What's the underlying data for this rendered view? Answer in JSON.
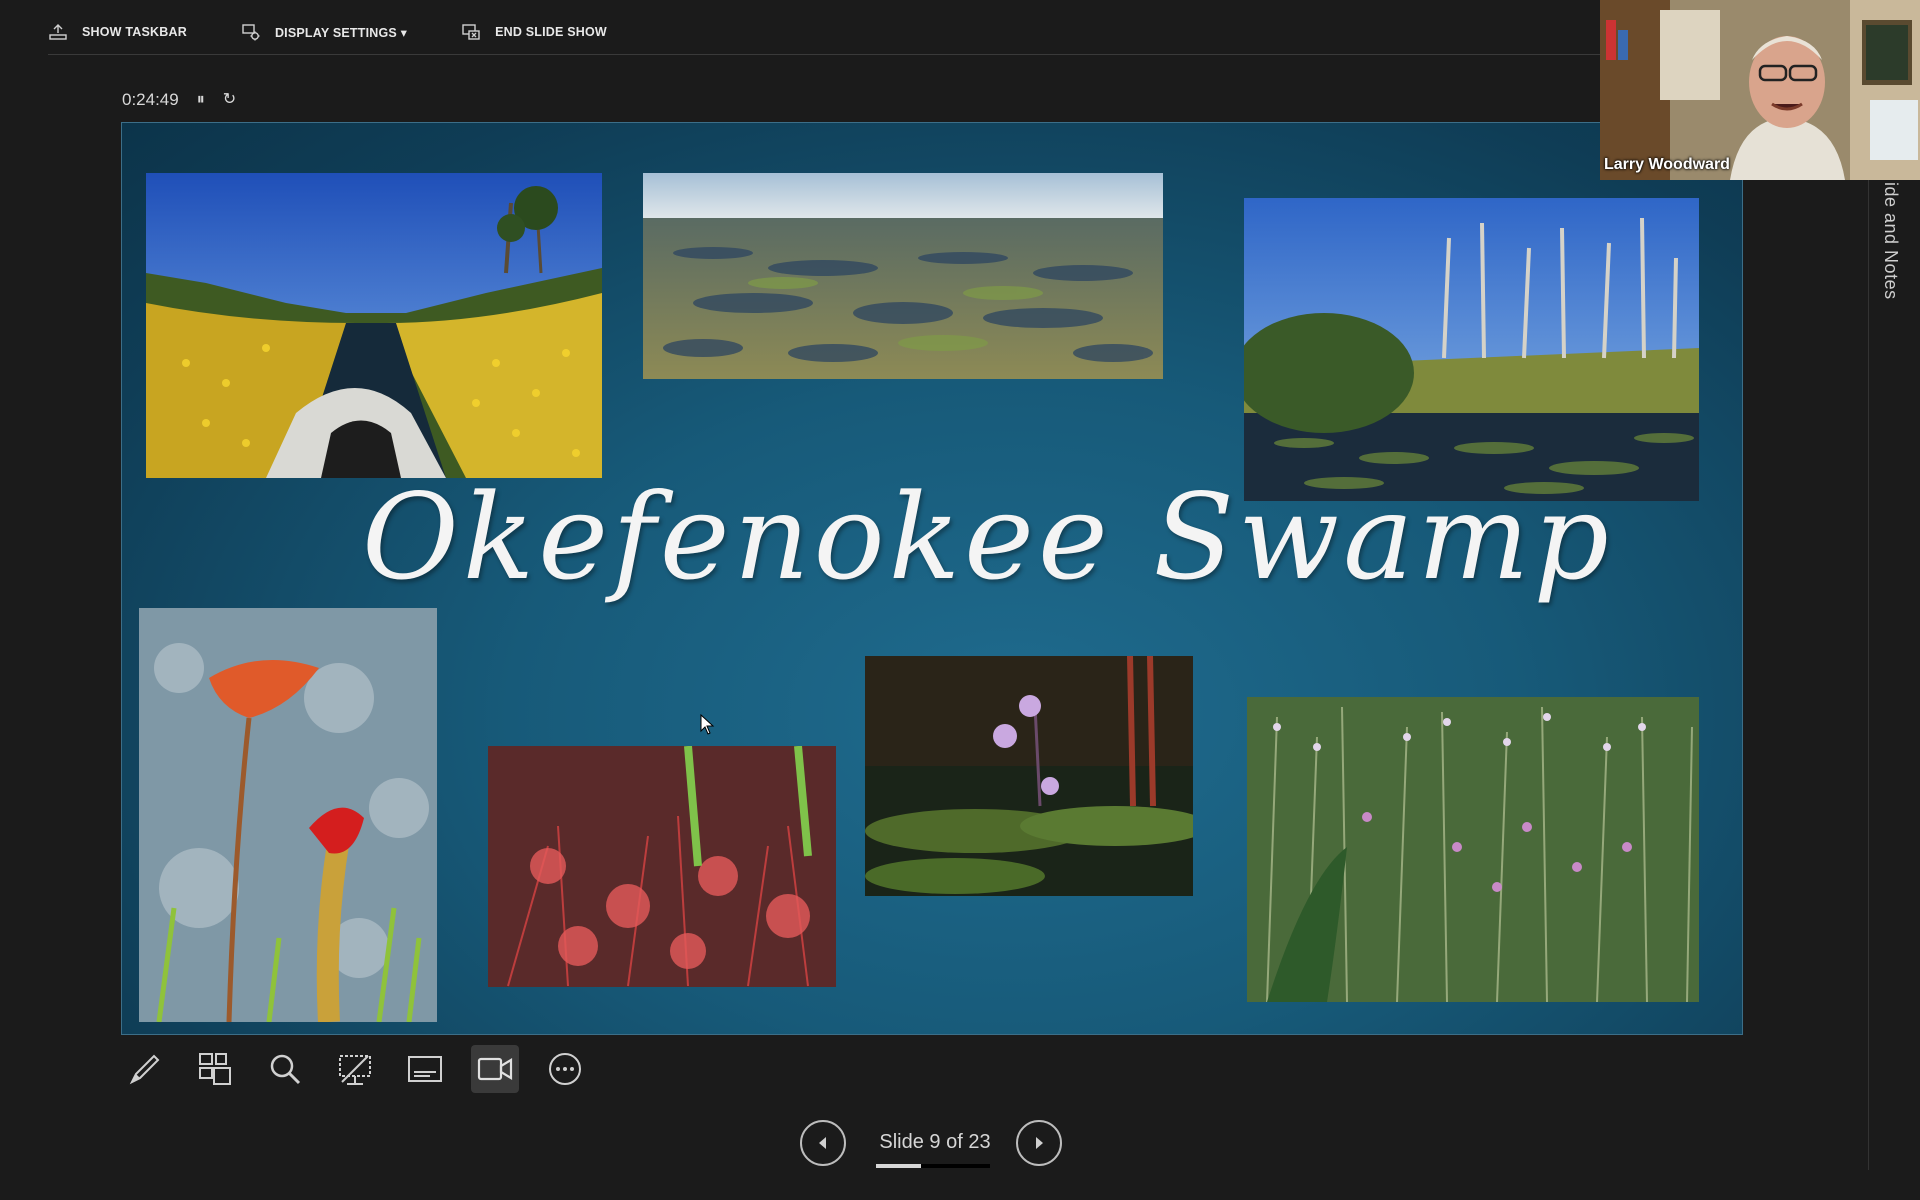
{
  "toolbar": {
    "show_taskbar": "SHOW TASKBAR",
    "display_settings": "DISPLAY SETTINGS ▾",
    "end_slide_show": "END SLIDE SHOW"
  },
  "timer": {
    "elapsed": "0:24:49",
    "pause_glyph": "⏸",
    "restart_glyph": "↻"
  },
  "slide": {
    "title": "Okefenokee Swamp"
  },
  "navigation": {
    "counter": "Slide 9 of 23",
    "current": 9,
    "total": 23
  },
  "sidebar": {
    "label": "ide and Notes"
  },
  "webcam": {
    "participant_name": "Larry Woodward"
  },
  "tools": [
    {
      "name": "pen-tool-button",
      "icon": "pen-icon"
    },
    {
      "name": "see-all-slides-button",
      "icon": "slides-grid-icon"
    },
    {
      "name": "zoom-button",
      "icon": "magnifier-icon"
    },
    {
      "name": "camera-toggle-button",
      "icon": "camera-icon"
    },
    {
      "name": "subtitles-button",
      "icon": "subtitles-icon"
    },
    {
      "name": "video-button",
      "icon": "video-icon"
    },
    {
      "name": "more-options-button",
      "icon": "ellipsis-icon"
    }
  ],
  "colors": {
    "background": "#1b1b1b",
    "slide_bg": "#175a79",
    "text": "#e6e6e6"
  }
}
